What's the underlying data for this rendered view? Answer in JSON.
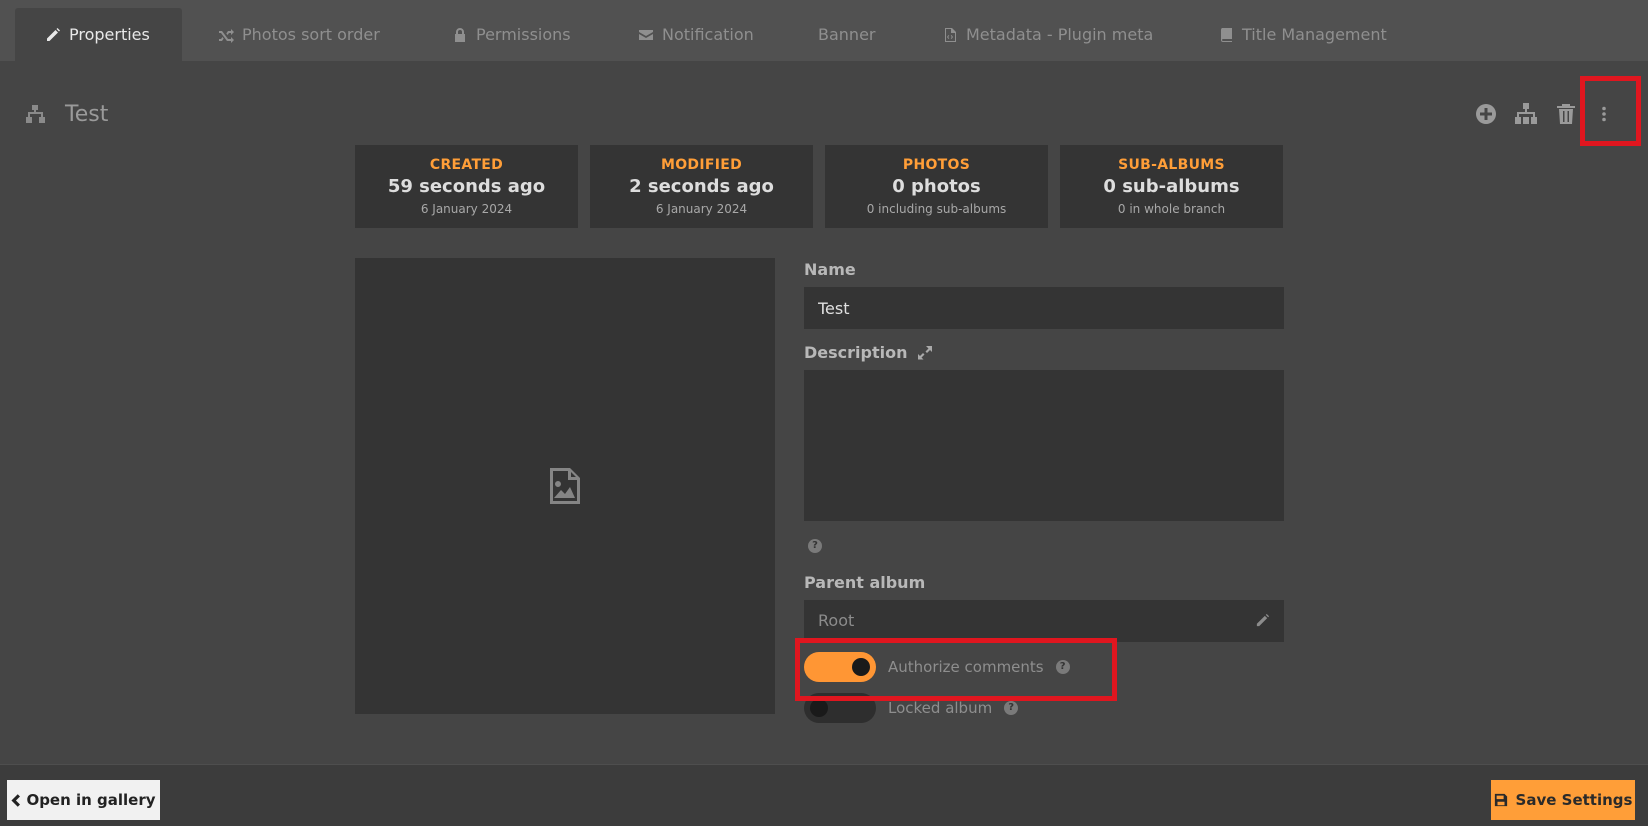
{
  "tabs": [
    {
      "label": "Properties",
      "icon": "pencil-icon",
      "active": true
    },
    {
      "label": "Photos sort order",
      "icon": "shuffle-icon"
    },
    {
      "label": "Permissions",
      "icon": "lock-icon"
    },
    {
      "label": "Notification",
      "icon": "envelope-icon"
    },
    {
      "label": "Banner",
      "icon": ""
    },
    {
      "label": "Metadata - Plugin meta",
      "icon": "file-code-icon"
    },
    {
      "label": "Title Management",
      "icon": "book-icon"
    }
  ],
  "album": {
    "title": "Test",
    "icon": "sitemap-icon"
  },
  "header_actions": [
    "add-circle-icon",
    "sitemap-icon",
    "trash-icon",
    "more-vertical-icon"
  ],
  "stats": [
    {
      "label": "CREATED",
      "value": "59 seconds ago",
      "sub": "6 January 2024"
    },
    {
      "label": "MODIFIED",
      "value": "2 seconds ago",
      "sub": "6 January 2024"
    },
    {
      "label": "PHOTOS",
      "value": "0 photos",
      "sub": "0 including sub-albums"
    },
    {
      "label": "SUB-ALBUMS",
      "value": "0 sub-albums",
      "sub": "0 in whole branch"
    }
  ],
  "form": {
    "name_label": "Name",
    "name_value": "Test",
    "description_label": "Description",
    "parent_label": "Parent album",
    "parent_value": "Root",
    "authorize_label": "Authorize comments",
    "authorize_on": true,
    "locked_label": "Locked album",
    "locked_on": false
  },
  "footer": {
    "open_label": "Open in gallery",
    "save_label": "Save Settings"
  },
  "colors": {
    "accent": "#ff9e38",
    "highlight": "#e0161f",
    "background": "#454545"
  }
}
